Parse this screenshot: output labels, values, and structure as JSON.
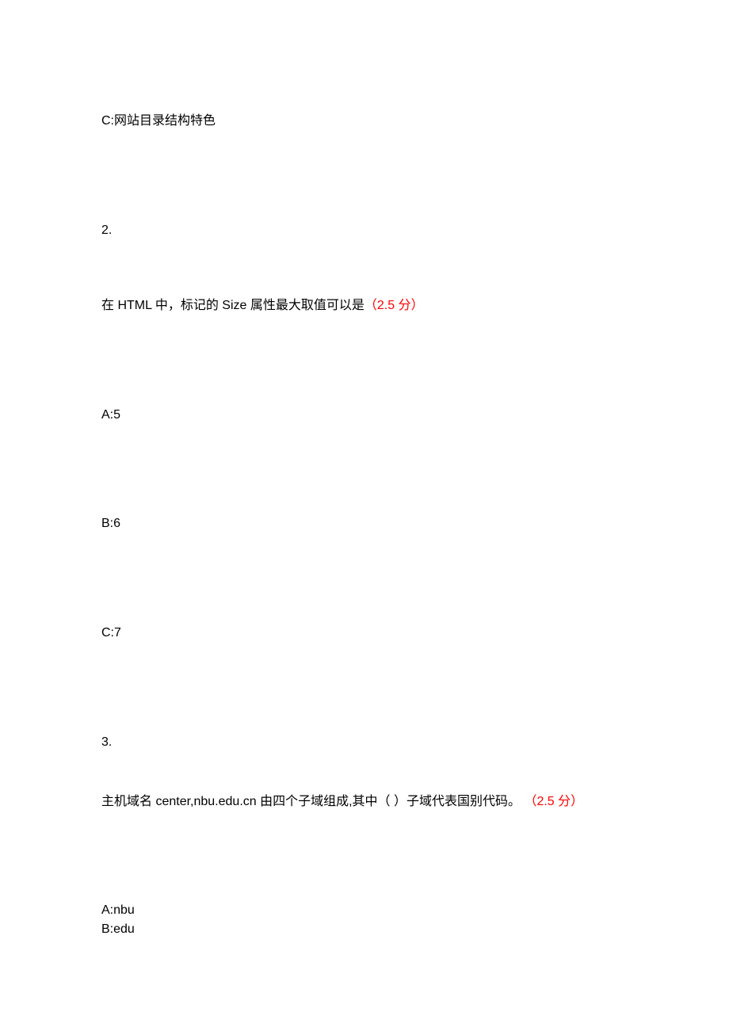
{
  "q1": {
    "optionC": "C:网站目录结构特色"
  },
  "q2": {
    "number": "2.",
    "text_prefix": "在 HTML 中，标记的 Size 属性最大取值可以是",
    "points": "（2.5 分）",
    "optionA": "A:5",
    "optionB": "B:6",
    "optionC": "C:7"
  },
  "q3": {
    "number": "3.",
    "text_prefix": "主机域名 center,nbu.edu.cn 由四个子域组成,其中（ ）子域代表国别代码。",
    "points": "（2.5 分）",
    "optionA": "A:nbu",
    "optionB": "B:edu"
  }
}
